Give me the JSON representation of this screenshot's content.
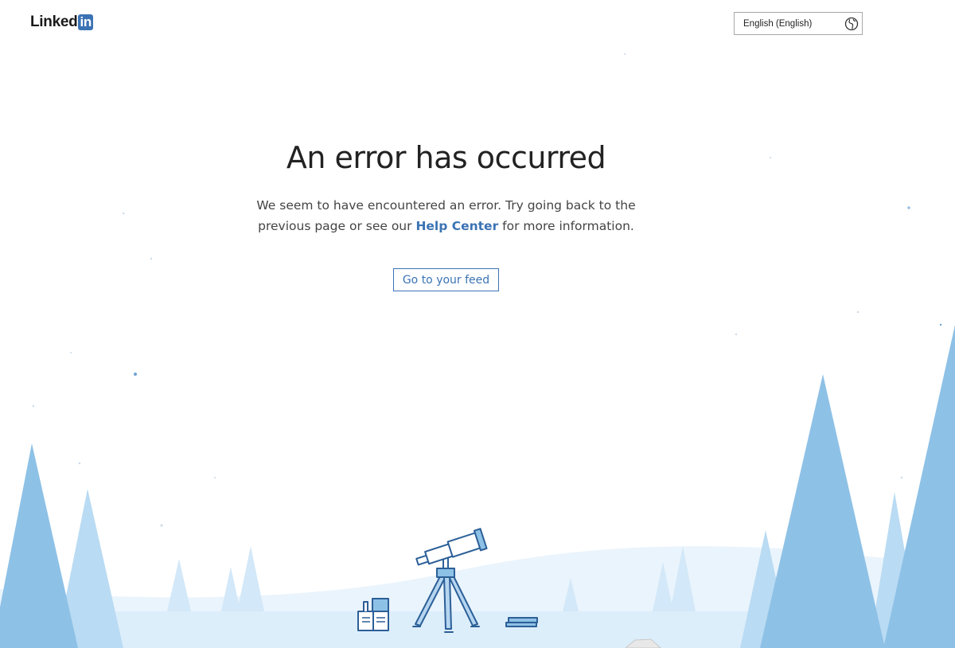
{
  "header": {
    "logo_text": "Linked",
    "logo_badge": "in",
    "language_selector": "English (English)"
  },
  "main": {
    "title": "An error has occurred",
    "description_before": "We seem to have encountered an error. Try going back to the previous page or see our ",
    "help_link": "Help Center",
    "description_after": " for more information.",
    "feed_button": "Go to your feed"
  },
  "colors": {
    "brand": "#3b73b4",
    "tree_dark": "#8ec1e6",
    "tree_light": "#b9dbf3",
    "ground": "#ddeefb"
  }
}
